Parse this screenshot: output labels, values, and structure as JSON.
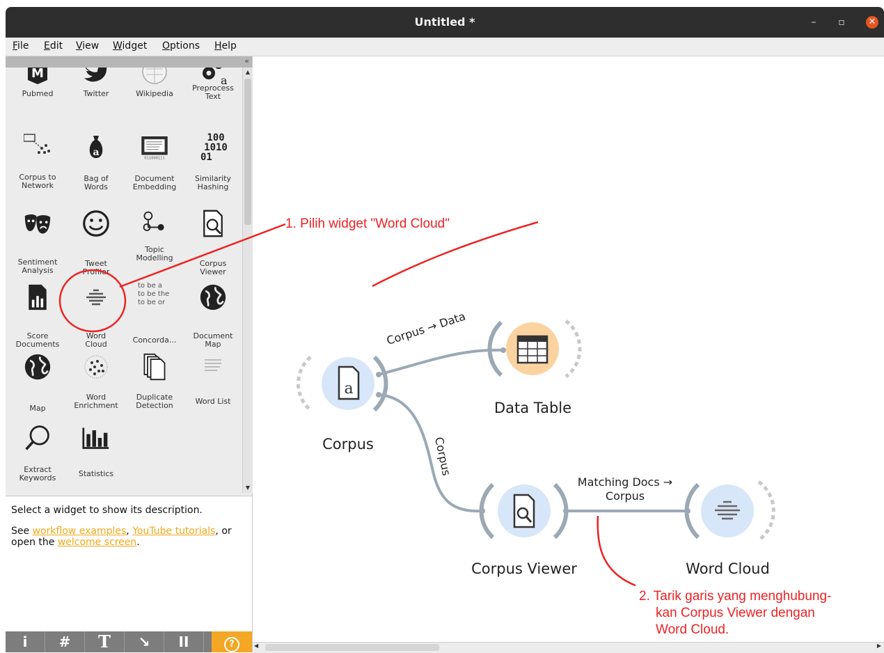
{
  "window": {
    "title": "Untitled *",
    "minimize": "–",
    "maximize": "▫",
    "close": "✕"
  },
  "menu": [
    "File",
    "Edit",
    "View",
    "Widget",
    "Options",
    "Help"
  ],
  "toolbox": {
    "collapse": "«",
    "widgets": [
      [
        "Pubmed"
      ],
      [
        "Twitter"
      ],
      [
        "Wikipedia"
      ],
      [
        "Preprocess",
        "Text"
      ],
      [
        "Corpus to",
        "Network"
      ],
      [
        "Bag of",
        "Words"
      ],
      [
        "Document",
        "Embedding"
      ],
      [
        "Similarity",
        "Hashing"
      ],
      [
        "Sentiment",
        "Analysis"
      ],
      [
        "Tweet",
        "Profiler"
      ],
      [
        "Topic",
        "Modelling"
      ],
      [
        "Corpus",
        "Viewer"
      ],
      [
        "Score",
        "Documents"
      ],
      [
        "Word",
        "Cloud"
      ],
      [
        "Concorda..."
      ],
      [
        "Document",
        "Map"
      ],
      [
        "Map"
      ],
      [
        "Word",
        "Enrichment"
      ],
      [
        "Duplicate",
        "Detection"
      ],
      [
        "Word List"
      ],
      [
        "Extract",
        "Keywords"
      ],
      [
        "Statistics"
      ]
    ],
    "concordance_text": [
      "to be a",
      "to be the",
      "to be or"
    ],
    "hashing_text": [
      "100",
      "1010",
      "01"
    ]
  },
  "help": {
    "line1": "Select a widget to show its description.",
    "see": "See ",
    "link1": "workflow examples",
    "comma": ", ",
    "link2": "YouTube tutorials",
    "or": ", or",
    "open": "open the ",
    "link3": "welcome screen",
    "period": "."
  },
  "bottom_toolbar": [
    "i",
    "#",
    "T",
    "↘",
    "II",
    "?"
  ],
  "workflow": {
    "nodes": {
      "corpus": "Corpus",
      "data_table": "Data Table",
      "corpus_viewer": "Corpus Viewer",
      "word_cloud": "Word Cloud"
    },
    "links": {
      "corpus_to_data": "Corpus → Data",
      "corpus_to_viewer": "Corpus",
      "viewer_to_cloud_1": "Matching Docs →",
      "viewer_to_cloud_2": "Corpus"
    }
  },
  "annotations": {
    "step1": "1. Pilih widget \"Word Cloud\"",
    "step2_line1": "2. Tarik garis yang menghubung-",
    "step2_line2": "kan Corpus Viewer dengan",
    "step2_line3": "Word Cloud."
  },
  "colors": {
    "accent": "#e95420",
    "annotation": "#ee2222",
    "node_blue": "#d8e6f9",
    "node_orange": "#fbd3a1",
    "link_gray": "#9ba9b5"
  }
}
